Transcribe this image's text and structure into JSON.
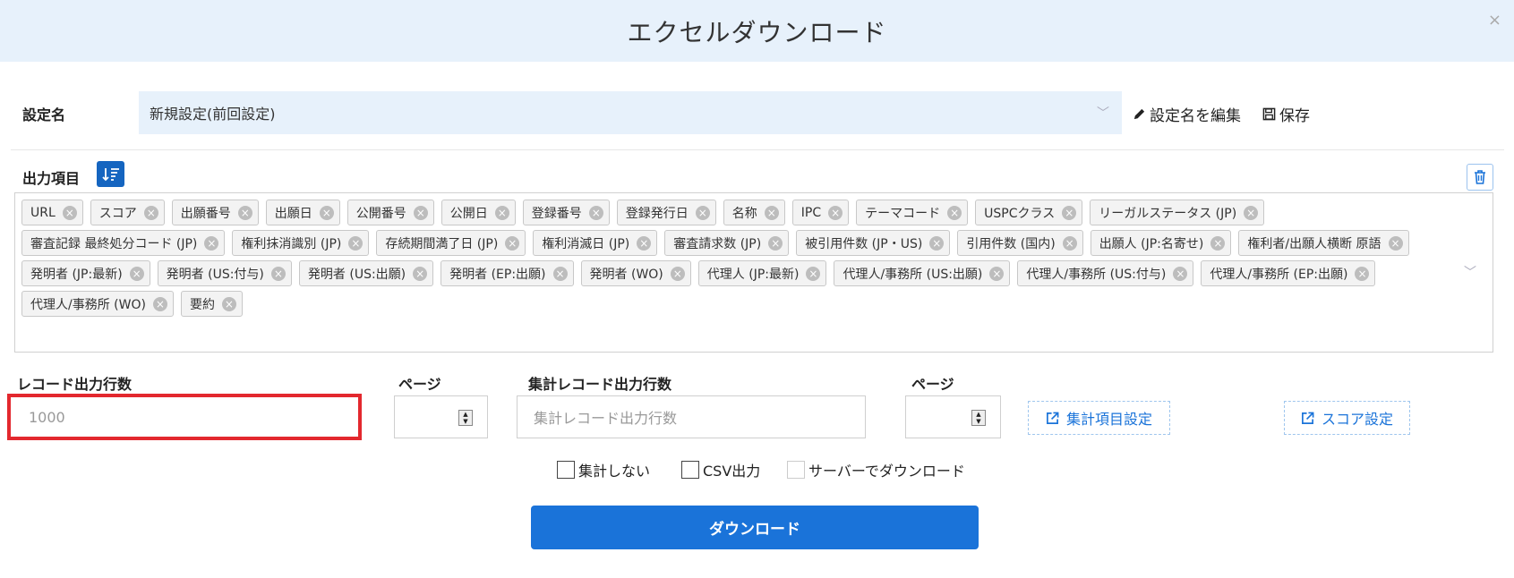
{
  "header": {
    "title": "エクセルダウンロード",
    "close_symbol": "×"
  },
  "settings": {
    "label": "設定名",
    "selected": "新規設定(前回設定)",
    "edit_label": "設定名を編集",
    "save_label": "保存"
  },
  "output_items": {
    "label": "出力項目",
    "tags": [
      "URL",
      "スコア",
      "出願番号",
      "出願日",
      "公開番号",
      "公開日",
      "登録番号",
      "登録発行日",
      "名称",
      "IPC",
      "テーマコード",
      "USPCクラス",
      "リーガルステータス (JP)",
      "審査記録 最終処分コード (JP)",
      "権利抹消識別 (JP)",
      "存続期間満了日 (JP)",
      "権利消滅日 (JP)",
      "審査請求数 (JP)",
      "被引用件数 (JP・US)",
      "引用件数 (国内)",
      "出願人 (JP:名寄せ)",
      "権利者/出願人横断 原語",
      "発明者 (JP:最新)",
      "発明者 (US:付与)",
      "発明者 (US:出願)",
      "発明者 (EP:出願)",
      "発明者 (WO)",
      "代理人 (JP:最新)",
      "代理人/事務所 (US:出願)",
      "代理人/事務所 (US:付与)",
      "代理人/事務所 (EP:出願)",
      "代理人/事務所 (WO)",
      "要約"
    ]
  },
  "records": {
    "label": "レコード出力行数",
    "value": "1000",
    "page_label": "ページ"
  },
  "aggregate": {
    "label": "集計レコード出力行数",
    "placeholder": "集計レコード出力行数",
    "page_label": "ページ",
    "settings_button": "集計項目設定"
  },
  "score": {
    "settings_button": "スコア設定"
  },
  "options": {
    "no_aggregate": "集計しない",
    "csv": "CSV出力",
    "server_download": "サーバーでダウンロード"
  },
  "download_button": "ダウンロード",
  "colors": {
    "accent": "#1a73d9",
    "header_bg": "#e7f1fb",
    "highlight": "#e3282e"
  }
}
